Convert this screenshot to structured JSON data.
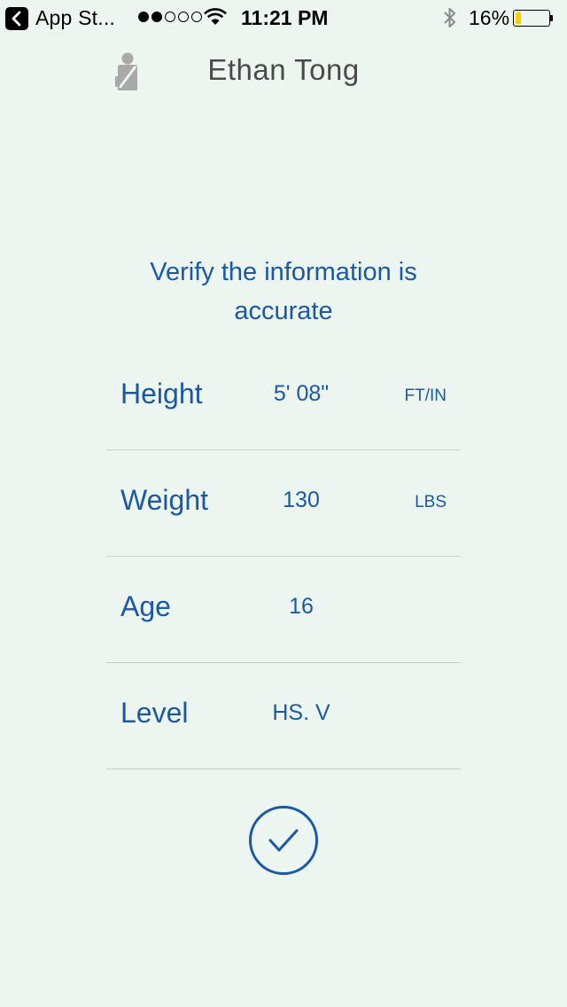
{
  "status_bar": {
    "back_app_label": "App St...",
    "time": "11:21 PM",
    "battery_percent": "16%",
    "battery_level": 0.16,
    "signal_bars_filled": 2,
    "signal_bars_total": 5
  },
  "header": {
    "user_name": "Ethan Tong",
    "avatar_icon": "person-seatbelt-icon"
  },
  "form": {
    "title": "Verify the information is accurate",
    "rows": [
      {
        "label": "Height",
        "value": "5' 08\"",
        "unit": "FT/IN"
      },
      {
        "label": "Weight",
        "value": "130",
        "unit": "LBS"
      },
      {
        "label": "Age",
        "value": "16",
        "unit": ""
      },
      {
        "label": "Level",
        "value": "HS. V",
        "unit": ""
      }
    ],
    "confirm_icon": "check-circle-icon"
  },
  "colors": {
    "background": "#edf5f1",
    "accent": "#1a58a8",
    "name_text": "#4a4a4a",
    "divider": "#c9cfcc",
    "battery_low": "#ffcc00"
  }
}
